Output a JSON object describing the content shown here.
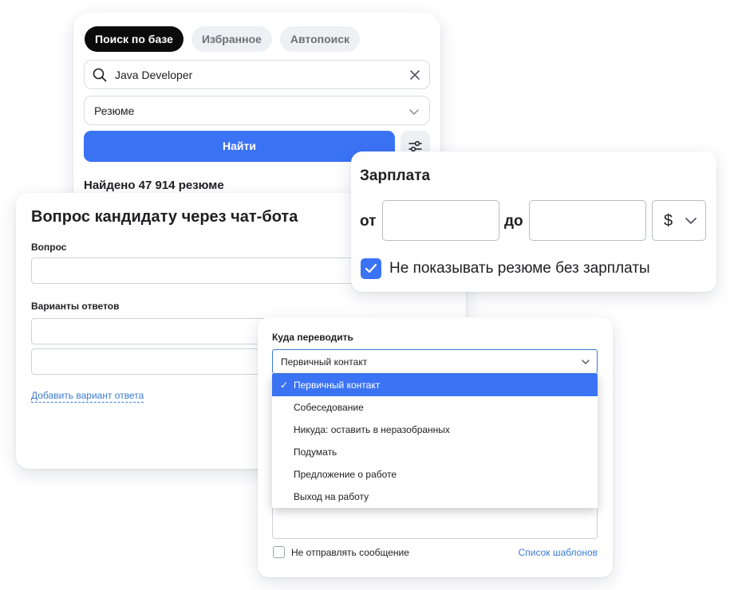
{
  "search": {
    "tabs": [
      {
        "label": "Поиск по базе",
        "active": true
      },
      {
        "label": "Избранное",
        "active": false
      },
      {
        "label": "Автопоиск",
        "active": false
      }
    ],
    "query": "Java Developer",
    "type_value": "Резюме",
    "find_label": "Найти",
    "found_text": "Найдено 47 914 резюме"
  },
  "chatbot": {
    "title": "Вопрос кандидату через чат-бота",
    "question_label": "Вопрос",
    "answers_label": "Варианты ответов",
    "add_variant_label": "Добавить вариант ответа"
  },
  "salary": {
    "title": "Зарплата",
    "from_label": "от",
    "to_label": "до",
    "currency": "$",
    "checkbox_label": "Не показывать резюме без зарплаты",
    "checkbox_checked": true
  },
  "transfer": {
    "label": "Куда переводить",
    "selected": "Первичный контакт",
    "options": [
      "Первичный контакт",
      "Собеседование",
      "Никуда: оставить в неразобранных",
      "Подумать",
      "Предложение о работе",
      "Выход на работу"
    ],
    "no_send_label": "Не отправлять сообщение",
    "templates_label": "Список шаблонов"
  },
  "colors": {
    "accent": "#3b73f5",
    "link": "#3a7bd5",
    "tab_active_bg": "#0b0b0c",
    "tab_bg": "#eef0f4"
  },
  "icons": [
    "search-icon",
    "clear-icon",
    "chevron-down-icon",
    "filter-icon",
    "checkmark-icon"
  ]
}
